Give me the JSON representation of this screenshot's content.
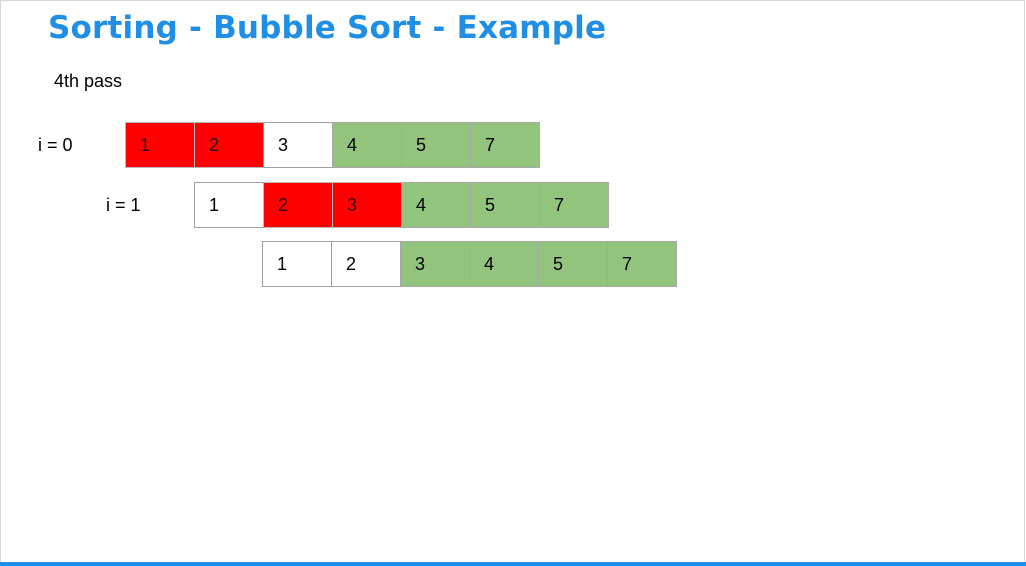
{
  "slide": {
    "title": "Sorting - Bubble Sort - Example",
    "subtitle": "4th pass"
  },
  "colors": {
    "accent": "#1e8ee6",
    "swap": "#ff0000",
    "sorted": "#93c47d",
    "unsorted": "#ffffff"
  },
  "rows": [
    {
      "label": "i = 0",
      "cells": [
        {
          "value": "1",
          "state": "swap"
        },
        {
          "value": "2",
          "state": "swap"
        },
        {
          "value": "3",
          "state": "unsorted"
        },
        {
          "value": "4",
          "state": "sorted"
        },
        {
          "value": "5",
          "state": "sorted"
        },
        {
          "value": "7",
          "state": "sorted"
        }
      ]
    },
    {
      "label": "i = 1",
      "cells": [
        {
          "value": "1",
          "state": "unsorted"
        },
        {
          "value": "2",
          "state": "swap"
        },
        {
          "value": "3",
          "state": "swap"
        },
        {
          "value": "4",
          "state": "sorted"
        },
        {
          "value": "5",
          "state": "sorted"
        },
        {
          "value": "7",
          "state": "sorted"
        }
      ]
    },
    {
      "label": "",
      "cells": [
        {
          "value": "1",
          "state": "unsorted"
        },
        {
          "value": "2",
          "state": "unsorted"
        },
        {
          "value": "3",
          "state": "sorted"
        },
        {
          "value": "4",
          "state": "sorted"
        },
        {
          "value": "5",
          "state": "sorted"
        },
        {
          "value": "7",
          "state": "sorted"
        }
      ]
    }
  ]
}
